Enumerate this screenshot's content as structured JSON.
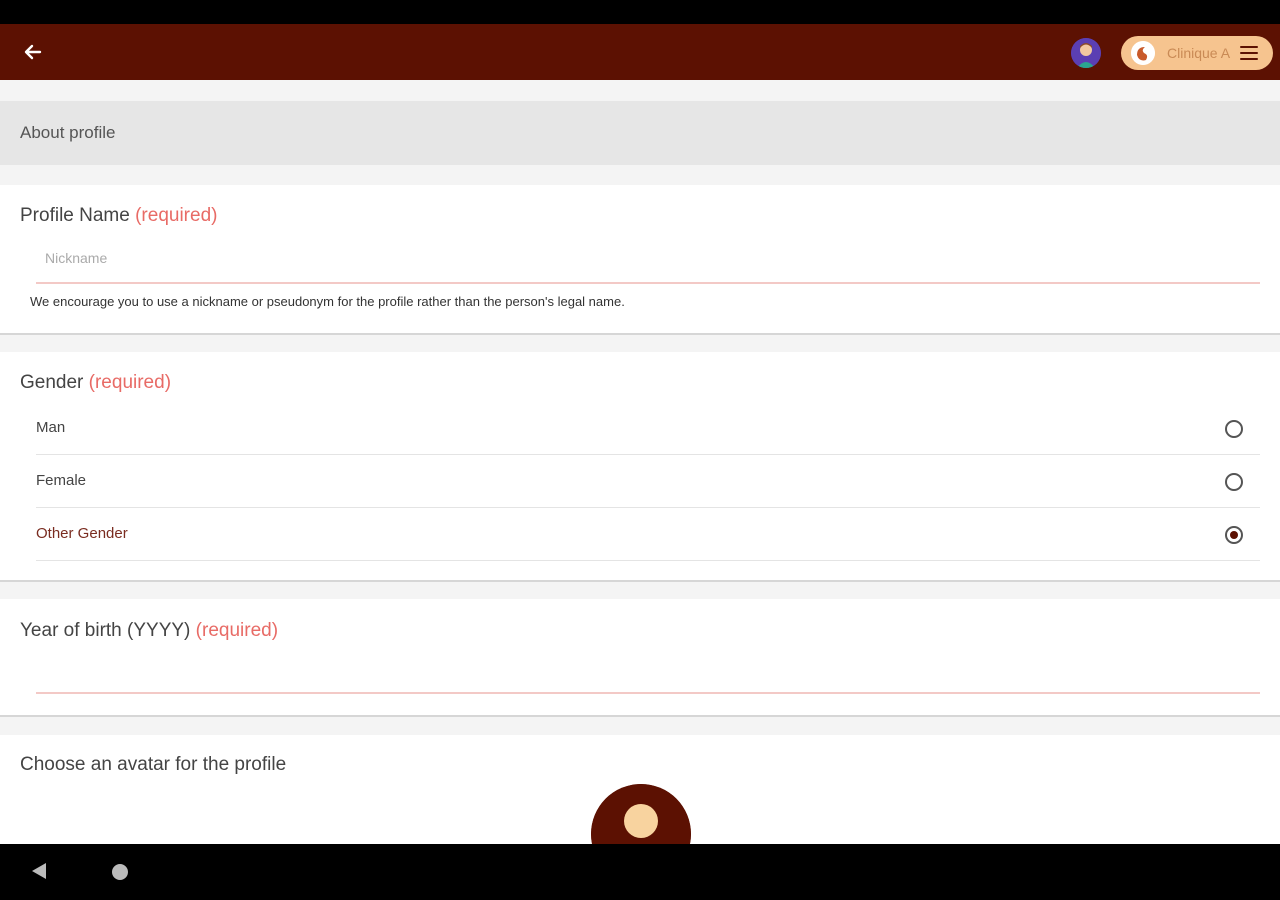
{
  "app_bar": {
    "clinic_name": "Clinique A",
    "colors": {
      "bar": "#5c1102",
      "pill": "#f6c48f"
    },
    "icons": [
      "back-arrow-icon",
      "user-avatar",
      "clinic-logo-icon",
      "menu-icon"
    ]
  },
  "section": {
    "title": "About profile"
  },
  "profile_name": {
    "label": "Profile Name",
    "required": "(required)",
    "value": "",
    "placeholder": "Nickname",
    "help": "We encourage you to use a nickname or pseudonym for the profile rather than the person's legal name."
  },
  "gender": {
    "label": "Gender",
    "required": "(required)",
    "options": [
      {
        "label": "Man",
        "selected": false
      },
      {
        "label": "Female",
        "selected": false
      },
      {
        "label": "Other Gender",
        "selected": true
      }
    ]
  },
  "year_of_birth": {
    "label": "Year of birth (YYYY)",
    "required": "(required)",
    "value": ""
  },
  "avatar": {
    "label": "Choose an avatar for the profile"
  }
}
